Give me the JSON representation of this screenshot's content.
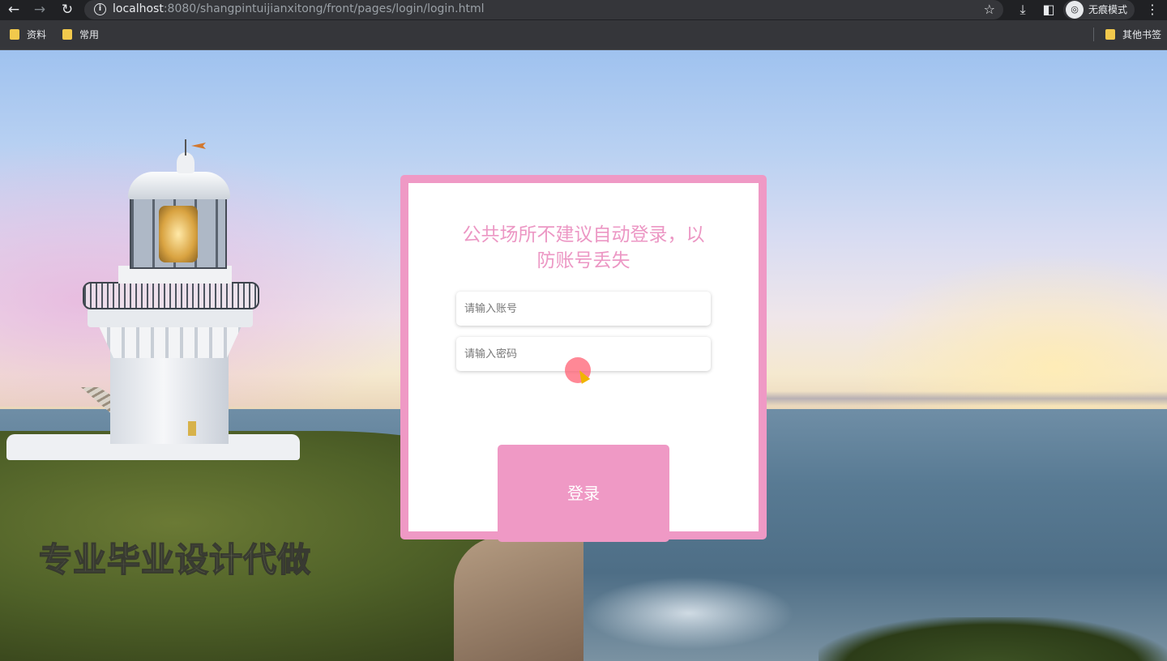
{
  "browser": {
    "url_host": "localhost",
    "url_rest": ":8080/shangpintuijianxitong/front/pages/login/login.html",
    "incognito_label": "无痕模式",
    "nav": {
      "back": "←",
      "forward": "→",
      "reload": "↻",
      "star": "☆",
      "download": "⤓",
      "sidebar": "◧",
      "menu": "⋮",
      "incognito_icon": "◎"
    }
  },
  "bookmarks": {
    "items": [
      {
        "label": "资料",
        "icon": "folder-icon"
      },
      {
        "label": "常用",
        "icon": "folder-icon"
      }
    ],
    "other": {
      "label": "其他书签",
      "icon": "folder-icon"
    }
  },
  "login": {
    "title": "公共场所不建议自动登录，以防账号丢失",
    "account_placeholder": "请输入账号",
    "password_placeholder": "请输入密码",
    "submit_label": "登录"
  },
  "background": {
    "watermark": "专业毕业设计代做"
  },
  "colors": {
    "accent": "#ef99c5",
    "title": "#ec97c4"
  }
}
